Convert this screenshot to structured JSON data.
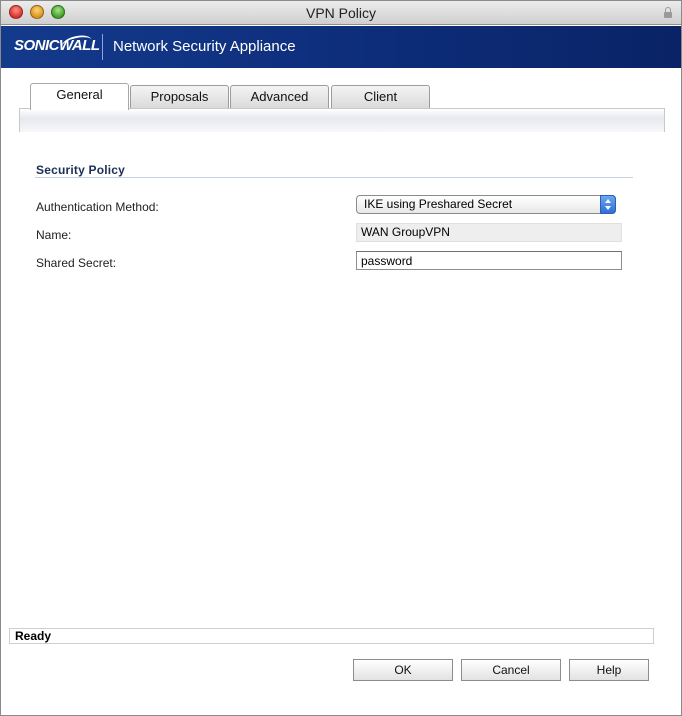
{
  "window": {
    "title": "VPN Policy"
  },
  "banner": {
    "logo": "SONICWALL",
    "product": "Network Security Appliance"
  },
  "tabs": [
    {
      "label": "General",
      "active": true
    },
    {
      "label": "Proposals",
      "active": false
    },
    {
      "label": "Advanced",
      "active": false
    },
    {
      "label": "Client",
      "active": false
    }
  ],
  "security_policy": {
    "heading": "Security Policy",
    "auth_method_label": "Authentication Method:",
    "auth_method_value": "IKE using Preshared Secret",
    "name_label": "Name:",
    "name_value": "WAN GroupVPN",
    "shared_secret_label": "Shared Secret:",
    "shared_secret_value": "password"
  },
  "status_bar": {
    "text": "Ready"
  },
  "buttons": {
    "ok": "OK",
    "cancel": "Cancel",
    "help": "Help"
  },
  "colors": {
    "banner": "#0d2d7a",
    "select_accent": "#2f6fd9",
    "section_heading": "#1b2f55"
  }
}
